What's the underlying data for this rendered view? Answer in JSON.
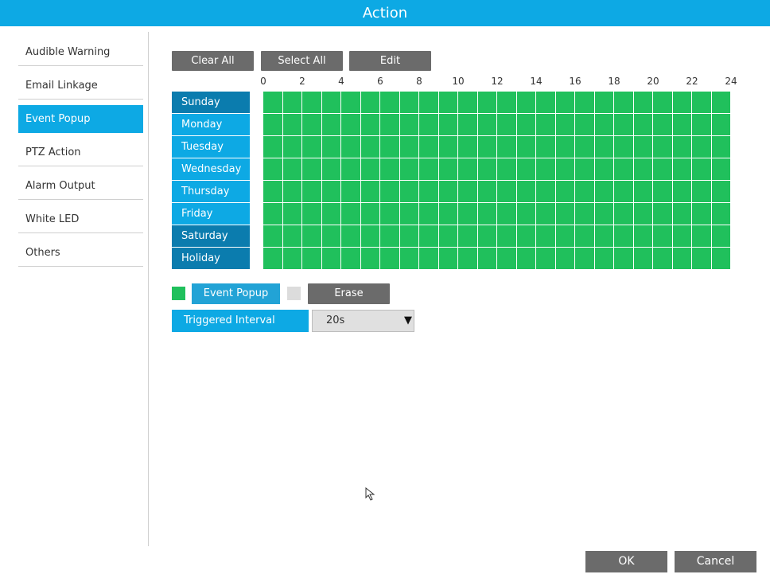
{
  "window": {
    "title": "Action"
  },
  "sidebar": {
    "items": [
      {
        "label": "Audible Warning",
        "active": false
      },
      {
        "label": "Email Linkage",
        "active": false
      },
      {
        "label": "Event Popup",
        "active": true
      },
      {
        "label": "PTZ Action",
        "active": false
      },
      {
        "label": "Alarm Output",
        "active": false
      },
      {
        "label": "White LED",
        "active": false
      },
      {
        "label": "Others",
        "active": false
      }
    ]
  },
  "toolbar": {
    "clear_all": "Clear All",
    "select_all": "Select All",
    "edit": "Edit"
  },
  "schedule": {
    "hours": [
      "0",
      "2",
      "4",
      "6",
      "8",
      "10",
      "12",
      "14",
      "16",
      "18",
      "20",
      "22",
      "24"
    ],
    "days": [
      "Sunday",
      "Monday",
      "Tuesday",
      "Wednesday",
      "Thursday",
      "Friday",
      "Saturday",
      "Holiday"
    ],
    "fill_color": "#20c05c",
    "all_selected": true
  },
  "legend": {
    "event_popup_label": "Event Popup",
    "event_popup_color": "#20c05c",
    "erase_label": "Erase",
    "erase_color": "#dcdcdc"
  },
  "triggered_interval": {
    "label": "Triggered Interval",
    "value": "20s"
  },
  "footer": {
    "ok": "OK",
    "cancel": "Cancel"
  },
  "colors": {
    "accent": "#0da9e4",
    "accent_dark": "#0b7cae",
    "button_gray": "#6b6b6b"
  }
}
